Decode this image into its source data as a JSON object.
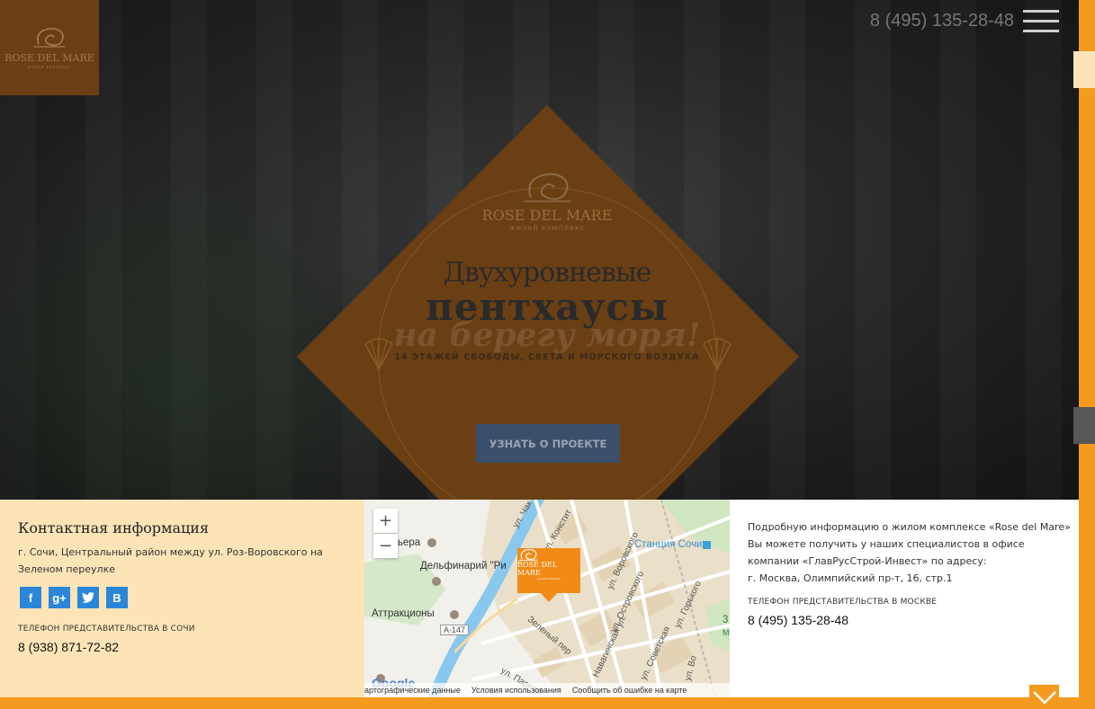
{
  "header": {
    "phone": "8 (495) 135-28-48",
    "logo_name": "ROSE DEL MARE",
    "logo_sub": "жилой комплекс"
  },
  "hero": {
    "logo_name": "ROSE DEL MARE",
    "logo_sub": "жилой комплекс",
    "line1": "Двухуровневые",
    "line2": "пентхаусы",
    "line3": "на берегу моря!",
    "tagline": "14 ЭТАЖЕЙ СВОБОДЫ, СВЕТА И МОРСКОГО ВОЗДУХА",
    "cta_label": "УЗНАТЬ О ПРОЕКТЕ"
  },
  "contact": {
    "title": "Контактная информация",
    "address": "г. Сочи, Центральный район между ул. Роз-Воровского на Зеленом переулке",
    "socials": [
      {
        "name": "facebook",
        "glyph": "f"
      },
      {
        "name": "google-plus",
        "glyph": "g+"
      },
      {
        "name": "twitter",
        "glyph": "t"
      },
      {
        "name": "vkontakte",
        "glyph": "В"
      }
    ],
    "sochi_label": "ТЕЛЕФОН ПРЕДСТАВИТЕЛЬСТВА В СОЧИ",
    "sochi_phone": "8 (938) 871-72-82"
  },
  "map": {
    "zoom_in": "+",
    "zoom_out": "−",
    "labels": {
      "riviera": "ьера",
      "dolphinarium": "Дельфинарий \"Ри",
      "attractions": "Аттракционы",
      "station": "Станция Сочи",
      "road": "А-147",
      "zeleny": "Зеленый пер",
      "parkovaya": "ул. Парков",
      "konst": "ул. Констит",
      "chak": "ул. Чак",
      "vorovskogo": "ул. Воровского",
      "ostrovskogo": "ул. Островского",
      "navaginskaya": "Навагинская ул.",
      "sovetskaya": "ул. Советская",
      "gorkogo": "ул. Горького",
      "vo": "ул. Во",
      "z3": "3",
      "m": "М"
    },
    "marker_name": "ROSE DEL MARE",
    "marker_sub": "жилой комплекс",
    "google": "Google",
    "footer": [
      "артографические данные",
      "Условия использования",
      "Сообщить об ошибке на карте"
    ]
  },
  "info": {
    "text": "Подробную информацию о жилом комплексе «Rose del Mare» Вы можете получить у наших специалистов в офисе компании «ГлавРусСтрой-Инвест» по адресу:",
    "address": "г. Москва, Олимпийский пр-т, 16, стр.1",
    "moscow_label": "ТЕЛЕФОН ПРЕДСТАВИТЕЛЬСТВА В МОСКВЕ",
    "moscow_phone": "8 (495) 135-28-48"
  },
  "icons": {
    "menu": "hamburger-menu-icon",
    "down": "chevron-down-icon",
    "shell": "shell-icon"
  },
  "colors": {
    "accent": "#f49a1e",
    "brown": "#6b3f14",
    "panel": "#fde4b7",
    "social": "#2b86d8"
  }
}
